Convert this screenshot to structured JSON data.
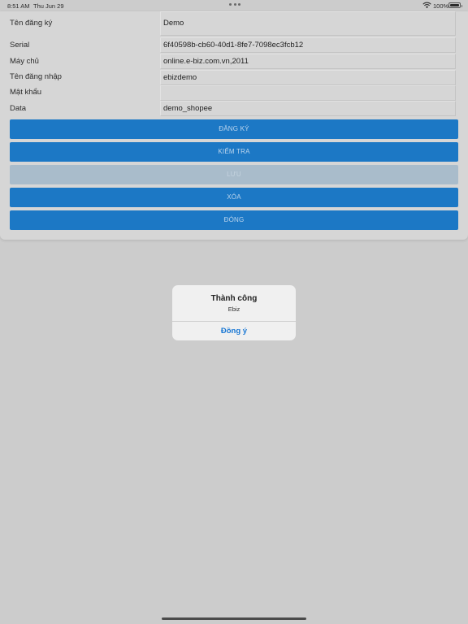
{
  "status_bar": {
    "time": "8:51 AM",
    "date": "Thu Jun 29",
    "battery_percent": "100%",
    "battery_level": 1.0
  },
  "form": {
    "fields": [
      {
        "label": "Tên đăng ký",
        "value": "Demo"
      },
      {
        "label": "Serial",
        "value": "6f40598b-cb60-40d1-8fe7-7098ec3fcb12"
      },
      {
        "label": "Máy chủ",
        "value": "online.e-biz.com.vn,2011"
      },
      {
        "label": "Tên đăng nhập",
        "value": "ebizdemo"
      },
      {
        "label": "Mật khẩu",
        "value": ""
      },
      {
        "label": "Data",
        "value": "demo_shopee"
      }
    ],
    "buttons": [
      {
        "label": "ĐĂNG KÝ",
        "enabled": true
      },
      {
        "label": "KIỂM TRA",
        "enabled": true
      },
      {
        "label": "LƯU",
        "enabled": false
      },
      {
        "label": "XÓA",
        "enabled": true
      },
      {
        "label": "ĐÓNG",
        "enabled": true
      }
    ]
  },
  "alert": {
    "title": "Thành công",
    "message": "Ebiz",
    "button_label": "Đồng ý"
  },
  "colors": {
    "button_blue": "#1c78c5",
    "button_disabled": "#a9bccb",
    "alert_action": "#1a78d4",
    "background": "#cccccc"
  },
  "icons": [
    "wifi-icon",
    "battery-icon",
    "multitasking-dots-icon"
  ]
}
